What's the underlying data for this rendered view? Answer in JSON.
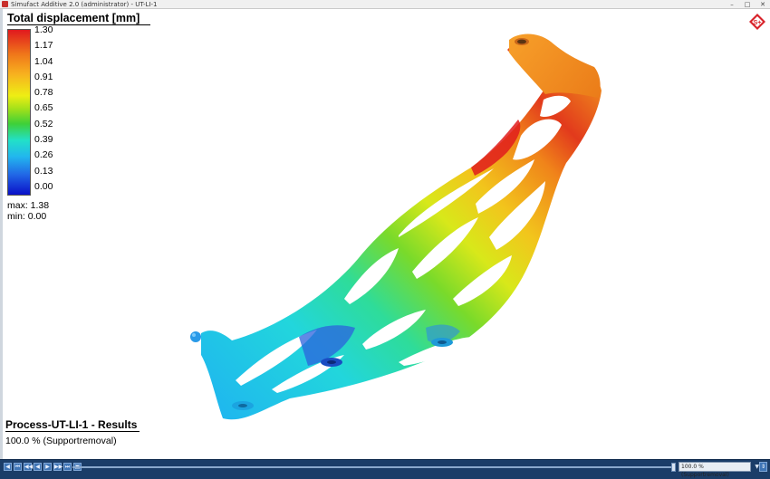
{
  "window": {
    "title": "Simufact Additive 2.0 (administrator) - UT-LI-1",
    "buttons": [
      "–",
      "□",
      "✕"
    ]
  },
  "legend": {
    "title": "Total displacement [mm]",
    "ticks": [
      "1.30",
      "1.17",
      "1.04",
      "0.91",
      "0.78",
      "0.65",
      "0.52",
      "0.39",
      "0.26",
      "0.13",
      "0.00"
    ],
    "max": "max: 1.38",
    "min": "min:  0.00",
    "colormap": [
      "#e0191e",
      "#f0781a",
      "#f7b21f",
      "#eeee14",
      "#a2e01a",
      "#3ed038",
      "#22e0c8",
      "#22b6ee",
      "#2166e6",
      "#0a10c8"
    ]
  },
  "logo": {
    "text": "S+",
    "icon": "simufact-logo-icon"
  },
  "result": {
    "title": "Process-UT-LI-1 - Results",
    "status": "100.0 % (Supportremoval)"
  },
  "playback": {
    "controls": [
      "◀",
      "⏮",
      "◀◀",
      "◀",
      "▶",
      "▶▶",
      "⏭",
      "▣"
    ],
    "progress": 1.0,
    "step_value": "100.0 % (Supportremoval)",
    "end_button": "⇕"
  }
}
